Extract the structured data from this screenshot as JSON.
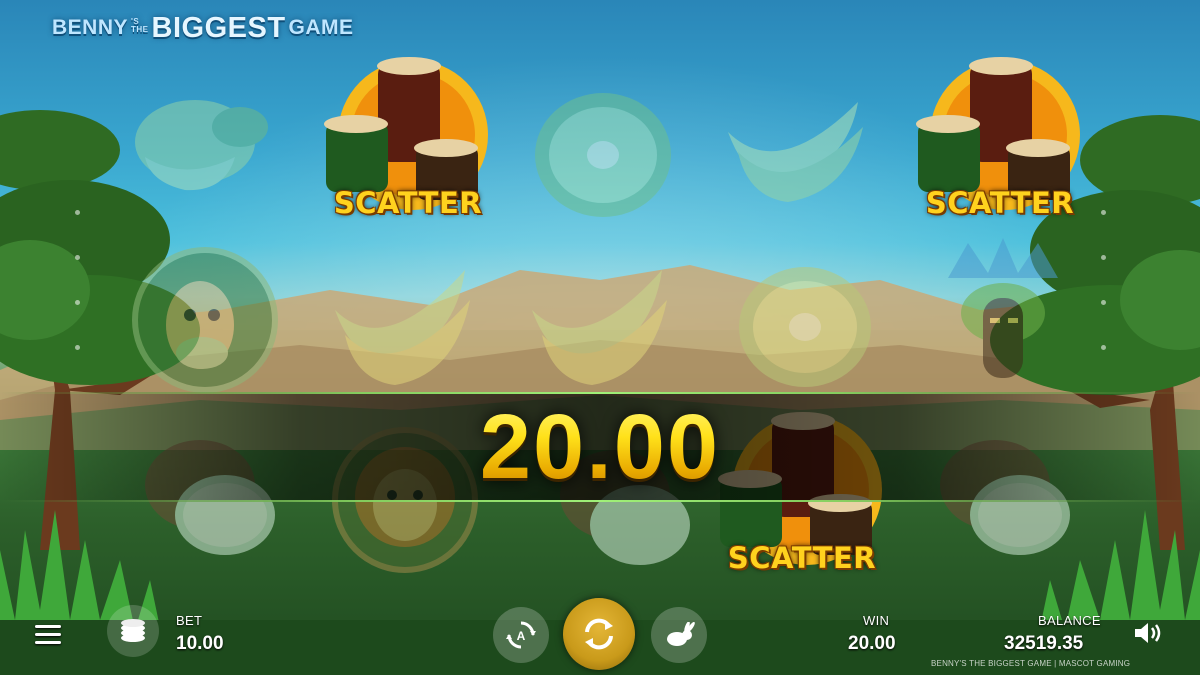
{
  "game": {
    "title_part1": "BENNY",
    "title_sup1": "'S",
    "title_sup2": "THE",
    "title_part2": "BIGGEST",
    "title_part3": "GAME"
  },
  "reels": {
    "scatter_label": "SCATTER",
    "symbols": [
      [
        "coconut-icon",
        "scatter-drums-icon",
        "kiwi-icon",
        "banana-icon",
        "kiwi-icon",
        "scatter-drums-icon"
      ],
      [
        "giraffe-icon",
        "banana-icon",
        "banana-icon",
        "kiwi-icon",
        "mask-icon"
      ],
      [
        "coconut-icon",
        "lion-icon",
        "coconut-icon",
        "scatter-drums-icon",
        "coconut-icon"
      ]
    ]
  },
  "win_banner": {
    "amount": "20.00"
  },
  "hud": {
    "bet_label": "BET",
    "bet_value": "10.00",
    "win_label": "WIN",
    "win_value": "20.00",
    "balance_label": "BALANCE",
    "balance_value": "32519.35",
    "credit": "BENNY'S THE BIGGEST GAME | MASCOT GAMING",
    "icons": {
      "menu": "hamburger-menu-icon",
      "bet": "coin-stack-icon",
      "autoplay": "autoplay-icon",
      "spin": "spin-arrows-icon",
      "turbo": "rabbit-icon",
      "sound": "speaker-icon"
    }
  },
  "colors": {
    "accent_gold": "#ffd21e",
    "spin_button": "#c99a1a",
    "hud_text": "#ffffff"
  }
}
